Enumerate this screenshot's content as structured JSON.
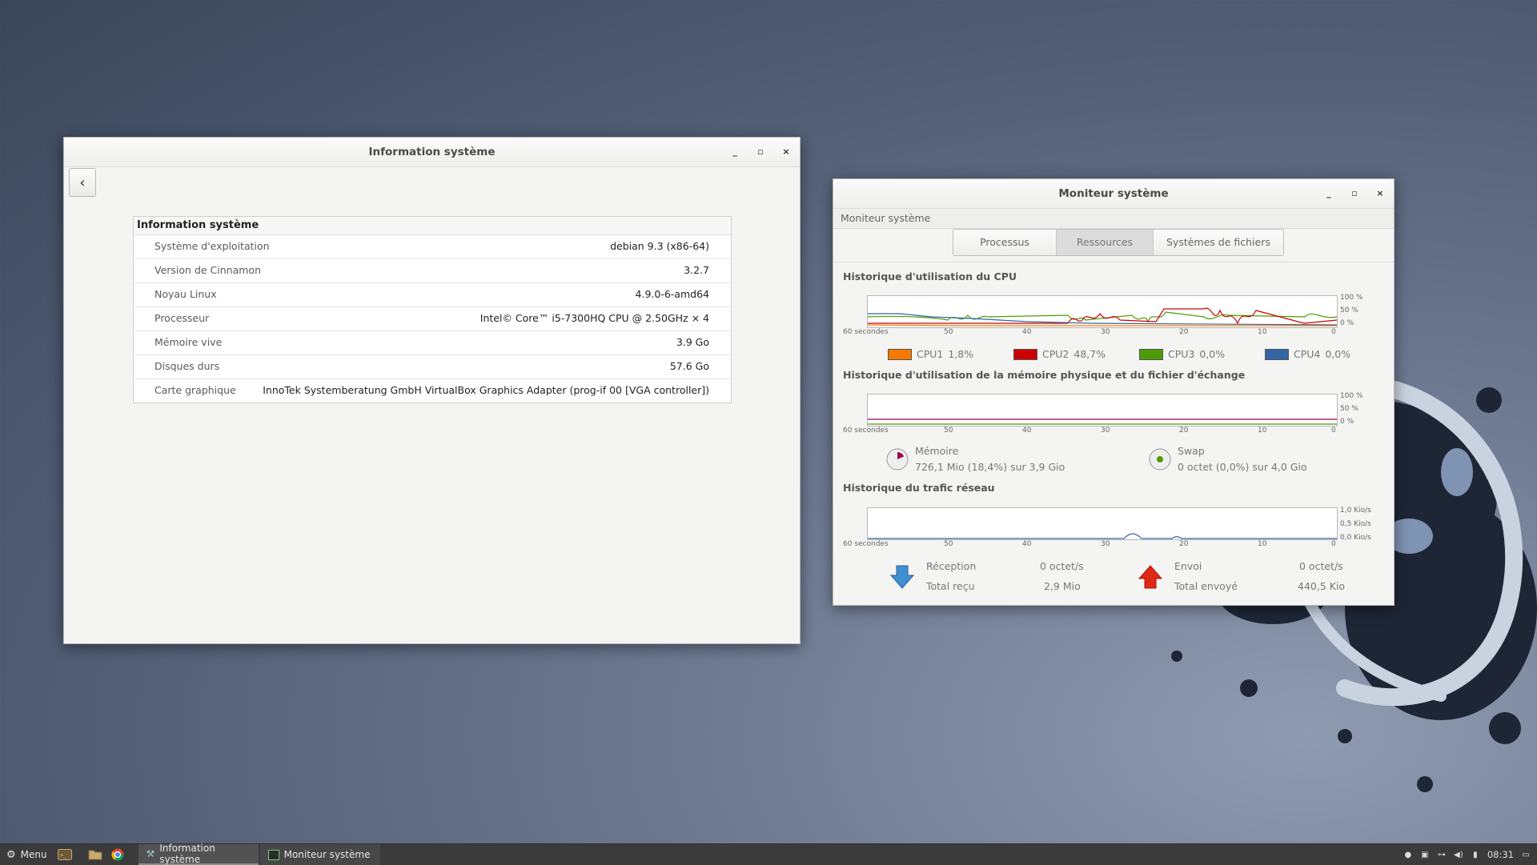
{
  "info_window": {
    "title": "Information système",
    "back_glyph": "‹",
    "table_title": "Information système",
    "rows": [
      {
        "key": "Système d'exploitation",
        "value": "debian 9.3 (x86-64)"
      },
      {
        "key": "Version de Cinnamon",
        "value": "3.2.7"
      },
      {
        "key": "Noyau Linux",
        "value": "4.9.0-6-amd64"
      },
      {
        "key": "Processeur",
        "value": "Intel© Core™ i5-7300HQ CPU @ 2.50GHz × 4"
      },
      {
        "key": "Mémoire vive",
        "value": "3.9 Go"
      },
      {
        "key": "Disques durs",
        "value": "57.6 Go"
      },
      {
        "key": "Carte graphique",
        "value": "InnoTek Systemberatung GmbH VirtualBox Graphics Adapter (prog-if 00 [VGA controller])"
      }
    ]
  },
  "window_controls": {
    "minimize": "_",
    "maximize": "▫",
    "close": "×"
  },
  "monitor_window": {
    "title": "Moniteur système",
    "subtitle": "Moniteur système",
    "tabs": [
      "Processus",
      "Ressources",
      "Systèmes de fichiers"
    ],
    "active_tab": "Ressources",
    "cpu_section": "Historique d'utilisation du CPU",
    "mem_section": "Historique d'utilisation de la mémoire physique et du fichier d'échange",
    "net_section": "Historique du trafic réseau",
    "x_labels": [
      "60 secondes",
      "50",
      "40",
      "30",
      "20",
      "10",
      "0"
    ],
    "pct_labels": [
      "100 %",
      "50 %",
      "0 %"
    ],
    "net_labels": [
      "1,0 Kio/s",
      "0,5 Kio/s",
      "0,0 Kio/s"
    ],
    "cpus": [
      {
        "name": "CPU1",
        "value": "1,8%",
        "color": "#f57900"
      },
      {
        "name": "CPU2",
        "value": "48,7%",
        "color": "#cc0000"
      },
      {
        "name": "CPU3",
        "value": "0,0%",
        "color": "#4e9a06"
      },
      {
        "name": "CPU4",
        "value": "0,0%",
        "color": "#3465a4"
      }
    ],
    "memory": {
      "label": "Mémoire",
      "detail": "726,1 Mio (18,4%) sur 3,9 Gio",
      "fraction": 0.184
    },
    "swap": {
      "label": "Swap",
      "detail": "0 octet (0,0%) sur 4,0 Gio",
      "fraction": 0.0
    },
    "network": {
      "reception_label": "Réception",
      "reception_value": "0 octet/s",
      "total_received_label": "Total reçu",
      "total_received_value": "2,9 Mio",
      "send_label": "Envoi",
      "send_value": "0 octet/s",
      "total_sent_label": "Total envoyé",
      "total_sent_value": "440,5 Kio"
    }
  },
  "taskbar": {
    "menu_label": "Menu",
    "tasks": [
      {
        "label": "Information système"
      },
      {
        "label": "Moniteur système"
      }
    ],
    "clock": "08:31"
  }
}
